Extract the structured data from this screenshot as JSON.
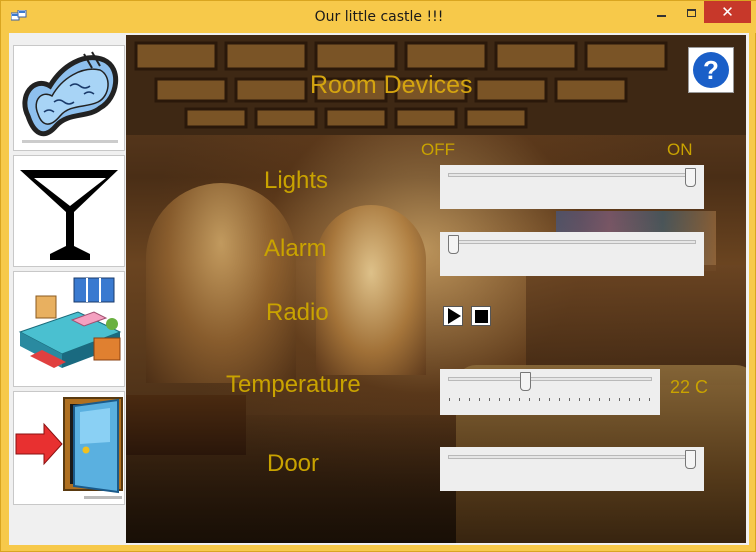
{
  "window": {
    "title": "Our little castle !!!",
    "min_icon": "minimize-icon",
    "max_icon": "maximize-icon",
    "close_icon": "close-icon",
    "close_glyph": "✕",
    "accent_color": "#f7c94a",
    "close_color": "#c7382a"
  },
  "nav": {
    "items": [
      {
        "name": "pool",
        "icon": "swimming-pool-icon"
      },
      {
        "name": "bar",
        "icon": "cocktail-glass-icon"
      },
      {
        "name": "bedroom",
        "icon": "bedroom-icon"
      },
      {
        "name": "exit",
        "icon": "exit-door-icon"
      }
    ]
  },
  "devices": {
    "heading": "Room Devices",
    "off_label": "OFF",
    "on_label": "ON",
    "label_color": "#c9a300",
    "lights": {
      "label": "Lights",
      "value": 1
    },
    "alarm": {
      "label": "Alarm",
      "value": 0
    },
    "radio": {
      "label": "Radio",
      "play_icon": "play-icon",
      "stop_icon": "stop-icon"
    },
    "temperature": {
      "label": "Temperature",
      "value_text": "22 C",
      "value": 22
    },
    "door": {
      "label": "Door",
      "value": 1
    }
  },
  "help": {
    "icon": "help-icon",
    "glyph": "?"
  }
}
